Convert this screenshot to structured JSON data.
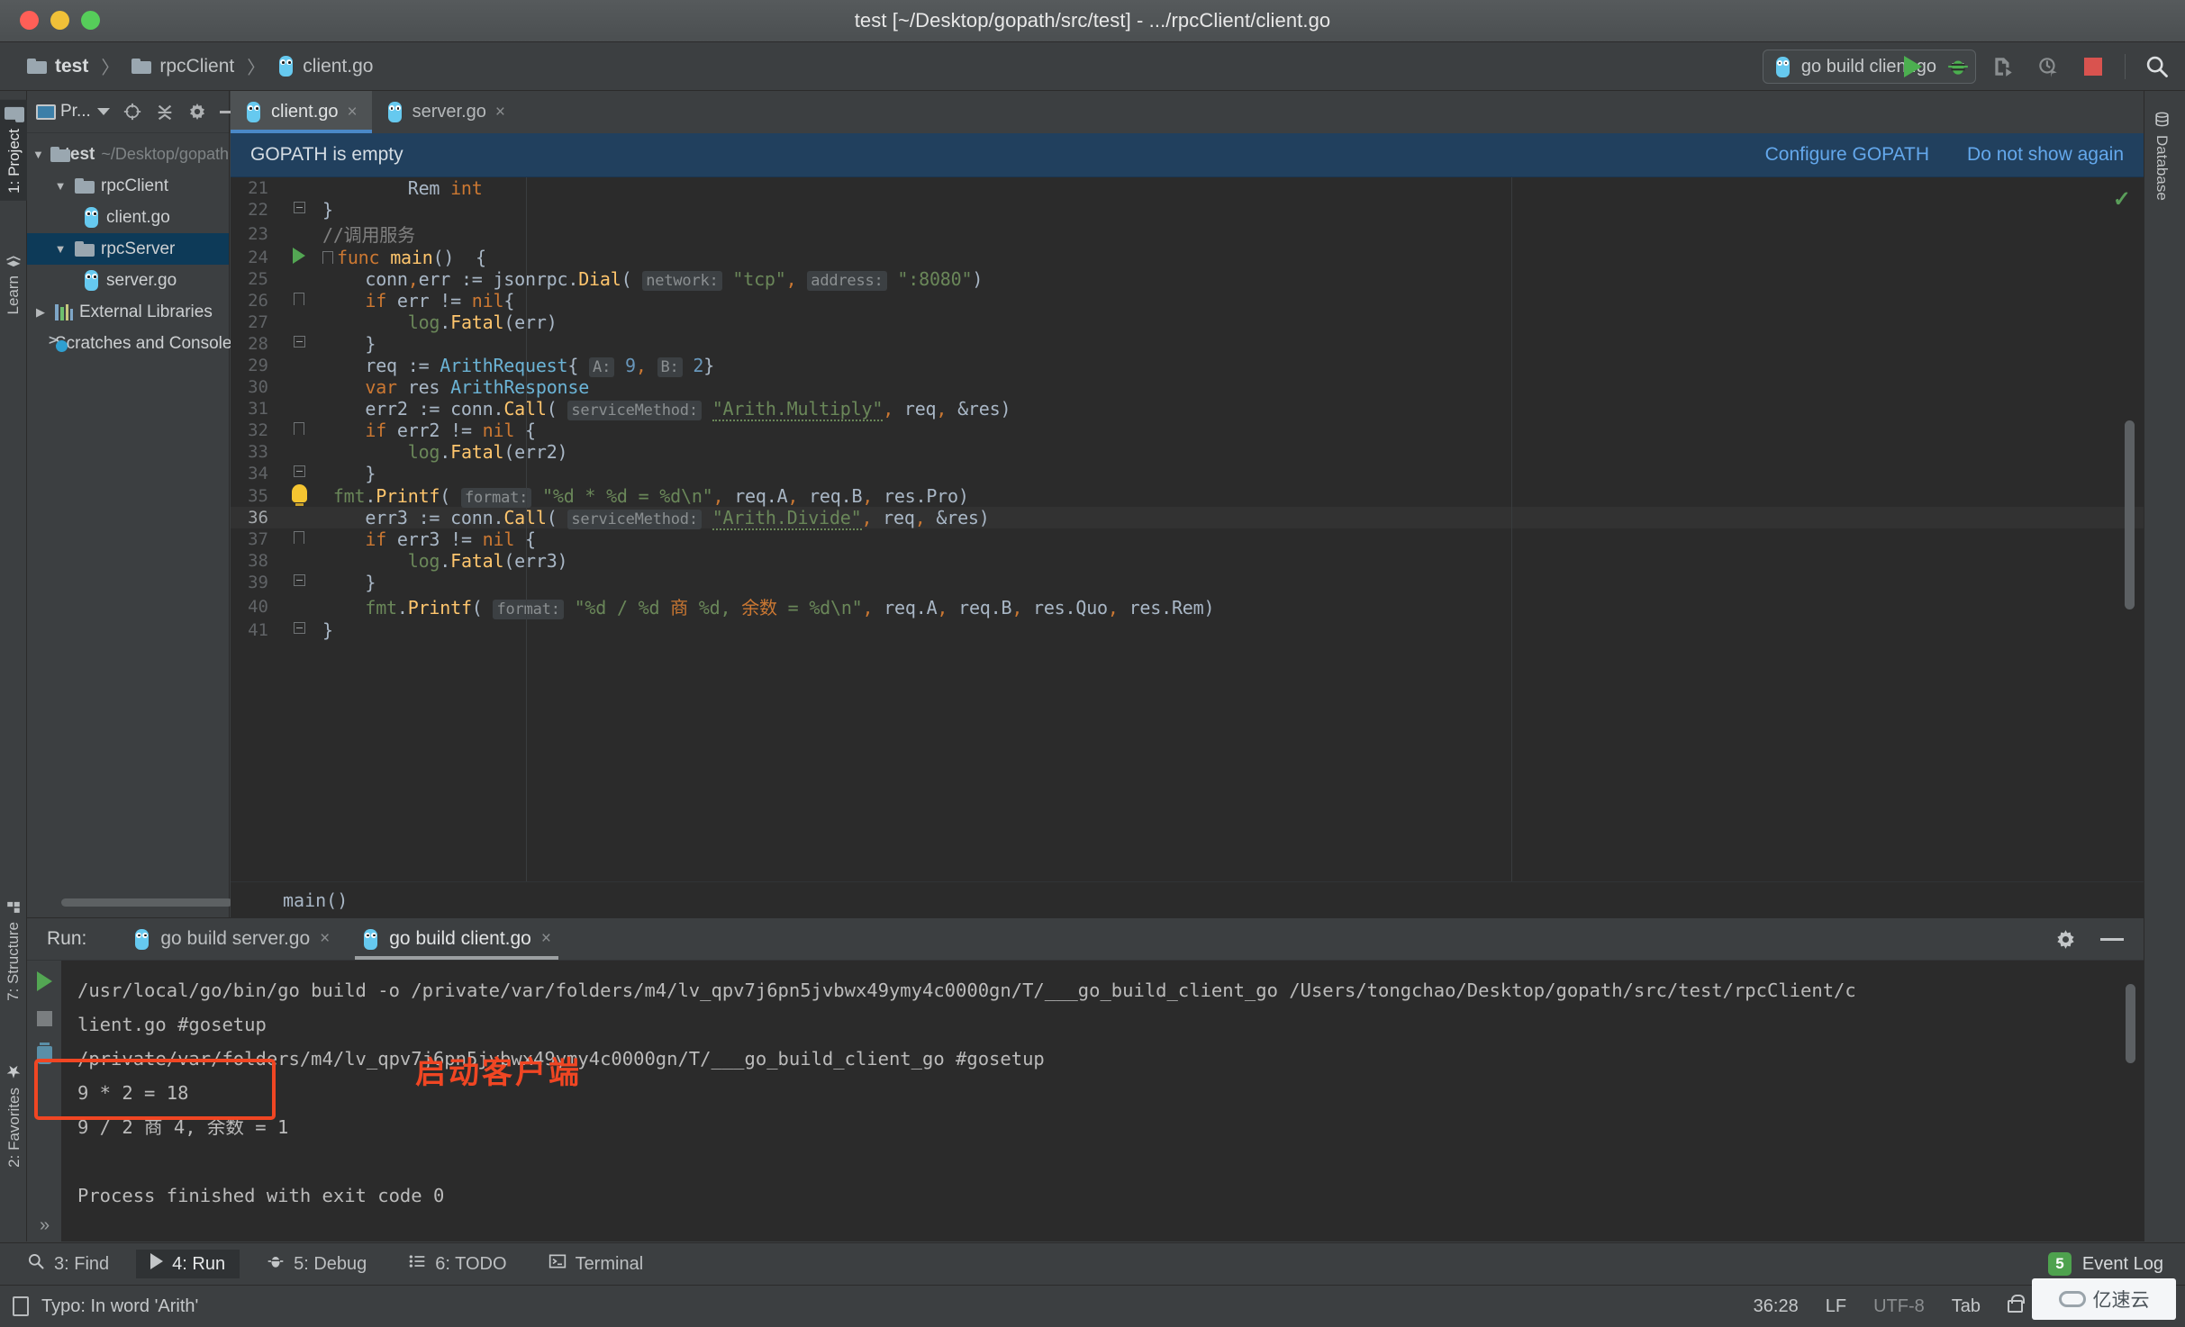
{
  "window": {
    "title": "test [~/Desktop/gopath/src/test] - .../rpcClient/client.go"
  },
  "breadcrumb": {
    "items": [
      {
        "label": "test",
        "icon": "folder-icon"
      },
      {
        "label": "rpcClient",
        "icon": "folder-icon"
      },
      {
        "label": "client.go",
        "icon": "go-file-icon"
      }
    ],
    "separator": "〉"
  },
  "toolbar": {
    "run_config": "go build client.go",
    "icons": [
      "run-icon",
      "debug-icon",
      "run-with-coverage-icon",
      "profile-icon",
      "stop-icon",
      "search-icon"
    ]
  },
  "left_strip": {
    "top_tabs": [
      {
        "label": "1: Project",
        "icon": "project-icon",
        "selected": true
      },
      {
        "label": "Learn",
        "icon": "learn-icon",
        "selected": false
      }
    ],
    "bottom_tabs": [
      {
        "label": "7: Structure",
        "icon": "structure-icon"
      },
      {
        "label": "2: Favorites",
        "icon": "star-icon"
      }
    ]
  },
  "right_strip": {
    "tabs": [
      {
        "label": "Database",
        "icon": "database-icon"
      }
    ]
  },
  "project": {
    "panel_label": "Pr...",
    "toolbar_icons": [
      "locate-icon",
      "collapse-all-icon",
      "settings-icon",
      "hide-icon"
    ],
    "tree": [
      {
        "indent": 0,
        "twisty": "▼",
        "icon": "folder-icon",
        "label": "test",
        "path": "~/Desktop/gopath",
        "bold": true,
        "selected": false
      },
      {
        "indent": 1,
        "twisty": "▼",
        "icon": "folder-icon",
        "label": "rpcClient",
        "path": "",
        "bold": false,
        "selected": false
      },
      {
        "indent": 2,
        "twisty": "",
        "icon": "go-file-icon",
        "label": "client.go",
        "path": "",
        "bold": false,
        "selected": false
      },
      {
        "indent": 1,
        "twisty": "▼",
        "icon": "folder-icon",
        "label": "rpcServer",
        "path": "",
        "bold": false,
        "selected": true
      },
      {
        "indent": 2,
        "twisty": "",
        "icon": "go-file-icon",
        "label": "server.go",
        "path": "",
        "bold": false,
        "selected": false
      },
      {
        "indent": 0,
        "twisty": "▶",
        "icon": "libraries-icon",
        "label": "External Libraries",
        "path": "",
        "bold": false,
        "selected": false
      },
      {
        "indent": 0,
        "twisty": "",
        "icon": "scratches-icon",
        "label": "Scratches and Console",
        "path": "",
        "bold": false,
        "selected": false
      }
    ]
  },
  "editor": {
    "tabs": [
      {
        "label": "client.go",
        "active": true,
        "close": "×"
      },
      {
        "label": "server.go",
        "active": false,
        "close": "×"
      }
    ],
    "notification": {
      "message": "GOPATH is empty",
      "actions": [
        "Configure GOPATH",
        "Do not show again"
      ]
    },
    "breadcrumb_bottom": "main()",
    "first_line_number": 21,
    "lines": [
      {
        "n": 21,
        "text": "        Rem int"
      },
      {
        "n": 22,
        "text": "}"
      },
      {
        "n": 23,
        "text": "    //调用服务"
      },
      {
        "n": 24,
        "text": "func main()  {"
      },
      {
        "n": 25,
        "text": "    conn,err := jsonrpc.Dial( network: \"tcp\", address: \":8080\")"
      },
      {
        "n": 26,
        "text": "    if err != nil{"
      },
      {
        "n": 27,
        "text": "        log.Fatal(err)"
      },
      {
        "n": 28,
        "text": "    }"
      },
      {
        "n": 29,
        "text": "    req := ArithRequest{ A: 9, B: 2}"
      },
      {
        "n": 30,
        "text": "    var res ArithResponse"
      },
      {
        "n": 31,
        "text": "    err2 := conn.Call( serviceMethod: \"Arith.Multiply\", req, &res)"
      },
      {
        "n": 32,
        "text": "    if err2 != nil {"
      },
      {
        "n": 33,
        "text": "        log.Fatal(err2)"
      },
      {
        "n": 34,
        "text": "    }"
      },
      {
        "n": 35,
        "text": "    fmt.Printf( format: \"%d * %d = %d\\n\", req.A, req.B, res.Pro)"
      },
      {
        "n": 36,
        "text": "    err3 := conn.Call( serviceMethod: \"Arith.Divide\", req, &res)"
      },
      {
        "n": 37,
        "text": "    if err3 != nil {"
      },
      {
        "n": 38,
        "text": "        log.Fatal(err3)"
      },
      {
        "n": 39,
        "text": "    }"
      },
      {
        "n": 40,
        "text": "    fmt.Printf( format: \"%d / %d 商 %d, 余数 = %d\\n\", req.A, req.B, res.Quo, res.Rem)"
      },
      {
        "n": 41,
        "text": "}"
      }
    ],
    "param_hints": [
      "network:",
      "address:",
      "A:",
      "B:",
      "serviceMethod:",
      "format:"
    ]
  },
  "run_window": {
    "title": "Run:",
    "tabs": [
      {
        "label": "go build server.go",
        "active": false,
        "close": "×"
      },
      {
        "label": "go build client.go",
        "active": true,
        "close": "×"
      }
    ],
    "header_icons": [
      "settings-icon",
      "hide-icon"
    ],
    "gutter_icons": [
      "rerun-icon",
      "stop-icon",
      "trash-icon"
    ],
    "console_lines": [
      "/usr/local/go/bin/go build -o /private/var/folders/m4/lv_qpv7j6pn5jvbwx49ymy4c0000gn/T/___go_build_client_go /Users/tongchao/Desktop/gopath/src/test/rpcClient/c",
      "lient.go #gosetup",
      "/private/var/folders/m4/lv_qpv7j6pn5jvbwx49ymy4c0000gn/T/___go_build_client_go #gosetup",
      "9 * 2 = 18",
      "9 / 2 商 4, 余数 = 1",
      "",
      "Process finished with exit code 0"
    ],
    "expand_chevron": "»"
  },
  "annotation": {
    "text": "启动客户端",
    "color": "#f04623",
    "highlight_box_color": "#f04623"
  },
  "bottom_bar": {
    "items": [
      {
        "label": "3: Find",
        "icon": "search-icon",
        "active": false
      },
      {
        "label": "4: Run",
        "icon": "run-icon",
        "active": true
      },
      {
        "label": "5: Debug",
        "icon": "debug-icon",
        "active": false
      },
      {
        "label": "6: TODO",
        "icon": "todo-icon",
        "active": false
      },
      {
        "label": "Terminal",
        "icon": "terminal-icon",
        "active": false
      }
    ],
    "event_log": {
      "label": "Event Log",
      "count": "5"
    }
  },
  "status_bar": {
    "message": "Typo: In word 'Arith'",
    "caret": "36:28",
    "line_sep": "LF",
    "encoding": "UTF-8",
    "indent": "Tab",
    "icons": [
      "lock-icon",
      "hat-icon",
      "hammer-icon",
      "help-icon"
    ],
    "watermark": "亿速云"
  }
}
